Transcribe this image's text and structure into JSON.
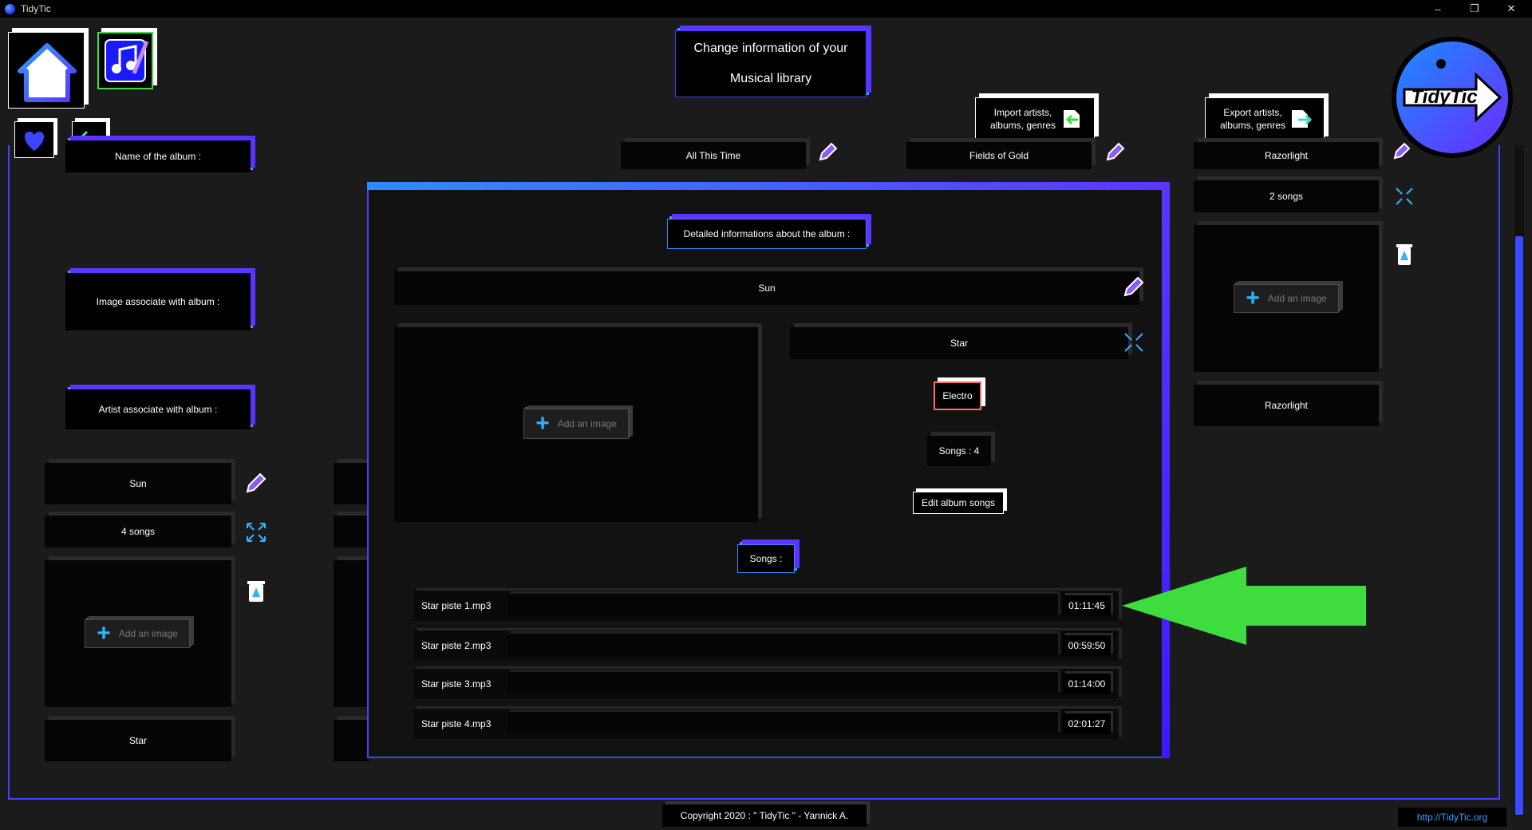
{
  "window": {
    "title": "TidyTic",
    "minimize": "–",
    "maximize": "❐",
    "close": "✕"
  },
  "header": {
    "title_line1": "Change information of your",
    "title_line2": "Musical library",
    "import_label": "Import artists, albums, genres",
    "export_label": "Export artists, albums, genres",
    "logo_text": "TidyTic"
  },
  "left_labels": {
    "album_name": "Name of the album :",
    "album_image": "Image associate with album :",
    "album_artist": "Artist associate with album :"
  },
  "background_albums": [
    {
      "name": "All This Time"
    },
    {
      "name": "Fields of Gold"
    },
    {
      "name": "Razorlight",
      "songs": "2 songs",
      "artist": "Razorlight"
    },
    {
      "name": "Sun",
      "songs": "4 songs",
      "artist": "Star"
    }
  ],
  "add_image_label": "Add an image",
  "modal": {
    "title": "Detailed informations about the album :",
    "album_name": "Sun",
    "artist": "Star",
    "genre": "Electro",
    "songs_count": "Songs  : 4",
    "edit_button": "Edit album songs",
    "songs_header": "Songs  :",
    "songs": [
      {
        "name": "Star piste 1.mp3",
        "duration": "01:11:45"
      },
      {
        "name": "Star piste 2.mp3",
        "duration": "00:59:50"
      },
      {
        "name": "Star piste 3.mp3",
        "duration": "01:14:00"
      },
      {
        "name": "Star piste 4.mp3",
        "duration": "02:01:27"
      }
    ]
  },
  "footer": {
    "copyright": "Copyright 2020 : \" TidyTic \" - Yannick A.",
    "link": "http://TidyTic.org"
  },
  "colors": {
    "accent_blue": "#3b46ff",
    "accent_purple": "#5b35ff",
    "highlight_arrow": "#3fdc3f",
    "genre_badge": "#ff6b6b"
  }
}
